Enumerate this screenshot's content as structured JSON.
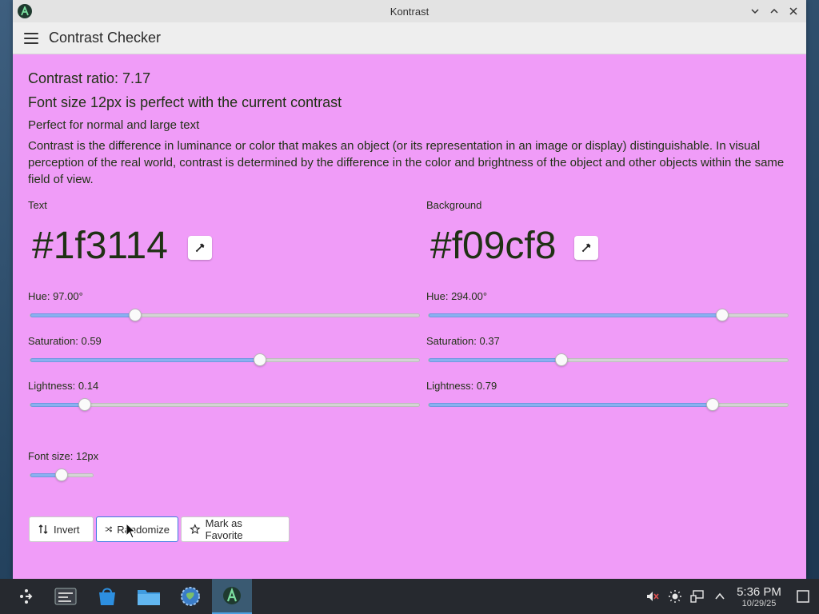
{
  "window": {
    "title": "Kontrast",
    "page_title": "Contrast Checker"
  },
  "summary": {
    "ratio": "Contrast ratio: 7.17",
    "font_message": "Font size 12px is perfect with the current contrast",
    "rating": "Perfect for normal and large text",
    "description": "Contrast is the difference in luminance or color that makes an object (or its representation in an image or display) distinguishable. In visual perception of the real world, contrast is determined by the difference in the color and brightness of the object and other objects within the same field of view."
  },
  "text_color": {
    "label": "Text",
    "hex": "#1f3114",
    "hue_label": "Hue: 97.00°",
    "hue_fraction": 0.2694,
    "saturation_label": "Saturation: 0.59",
    "saturation_fraction": 0.59,
    "lightness_label": "Lightness: 0.14",
    "lightness_fraction": 0.14
  },
  "background_color": {
    "label": "Background",
    "hex": "#f09cf8",
    "hue_label": "Hue: 294.00°",
    "hue_fraction": 0.8167,
    "saturation_label": "Saturation: 0.37",
    "saturation_fraction": 0.37,
    "lightness_label": "Lightness: 0.79",
    "lightness_fraction": 0.79
  },
  "font_size": {
    "label": "Font size: 12px",
    "fraction": 0.5
  },
  "buttons": {
    "invert": "Invert",
    "randomize": "Randomize",
    "favorite": "Mark as Favorite"
  },
  "clock": {
    "time": "5:36 PM",
    "date": "10/29/25"
  },
  "colors": {
    "text": "#1f3114",
    "background": "#f09cf8",
    "accent": "#8ab0f0"
  }
}
